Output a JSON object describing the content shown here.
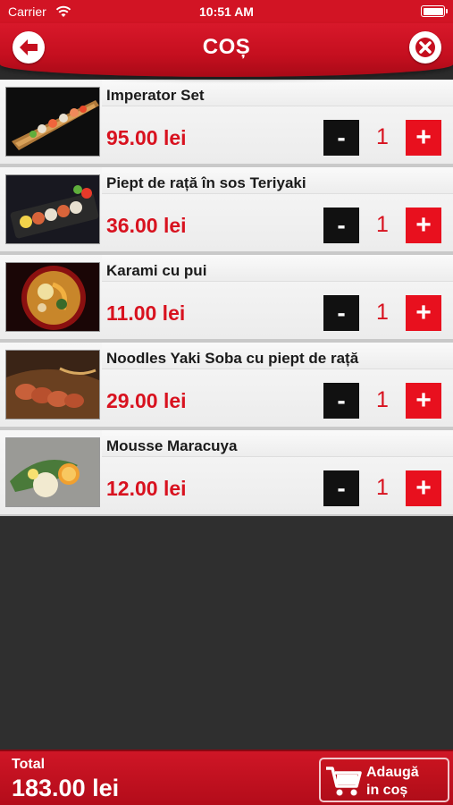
{
  "status_bar": {
    "carrier": "Carrier",
    "time": "10:51 AM"
  },
  "header": {
    "title": "COȘ",
    "back_icon": "arrow-left-icon",
    "close_icon": "close-icon"
  },
  "cart": {
    "items": [
      {
        "name": "Imperator Set",
        "price": "95.00 lei",
        "quantity": "1",
        "image": "sushi-boat-image"
      },
      {
        "name": "Piept de rață în sos Teriyaki",
        "price": "36.00 lei",
        "quantity": "1",
        "image": "duck-roll-image"
      },
      {
        "name": "Karami cu pui",
        "price": "11.00 lei",
        "quantity": "1",
        "image": "ramen-bowl-image"
      },
      {
        "name": "Noodles Yaki Soba cu piept de rață",
        "price": "29.00 lei",
        "quantity": "1",
        "image": "noodles-duck-image"
      },
      {
        "name": "Mousse Maracuya",
        "price": "12.00 lei",
        "quantity": "1",
        "image": "mousse-dessert-image"
      }
    ],
    "minus_label": "-",
    "plus_label": "+"
  },
  "footer": {
    "total_label": "Total",
    "total_value": "183.00 lei",
    "add_button_label": "Adaugă\nin coș"
  },
  "colors": {
    "brand_red": "#d21424",
    "price_red": "#d8121f",
    "minus_bg": "#111111"
  }
}
